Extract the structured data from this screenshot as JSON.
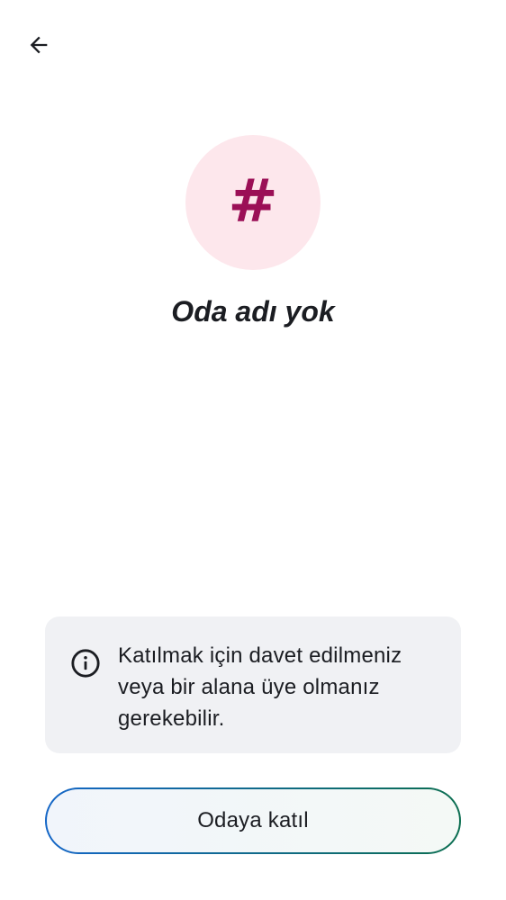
{
  "header": {
    "back_icon": "arrow-left-icon"
  },
  "room": {
    "avatar_glyph": "#",
    "avatar_icon": "hash-icon",
    "title": "Oda adı yok"
  },
  "info": {
    "icon": "info-circle-icon",
    "message": "Katılmak için davet edilmeniz veya bir alana üye olmanız gerekebilir."
  },
  "actions": {
    "join_label": "Odaya katıl"
  },
  "colors": {
    "avatar_background": "#fde7ec",
    "avatar_glyph": "#9b0f56",
    "info_card_background": "#f0f1f4",
    "join_border_start": "#1466c7",
    "join_border_end": "#0b6e50",
    "text_primary": "#1b1d22"
  }
}
